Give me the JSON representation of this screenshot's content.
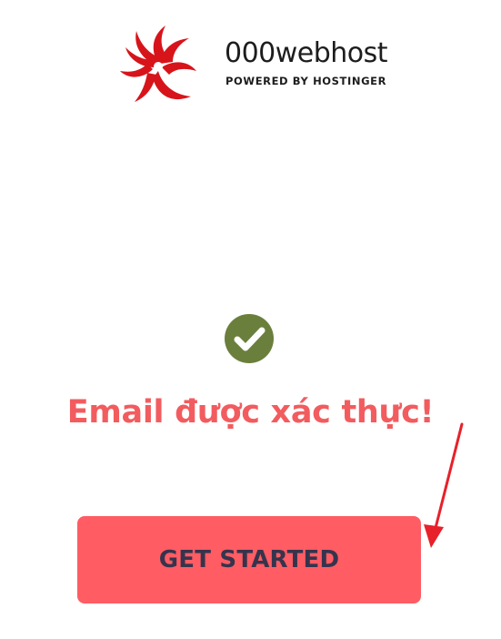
{
  "brand": {
    "name": "000webhost",
    "tagline": "POWERED BY HOSTINGER",
    "logo_icon": "spiral-logo-icon",
    "color": "#d7141a"
  },
  "status": {
    "icon": "check-circle-icon",
    "icon_color": "#6b7f3d",
    "message": "Email được xác thực!",
    "message_color": "#f25c5f"
  },
  "actions": {
    "get_started_label": "GET STARTED",
    "button_color": "#ff5c63"
  },
  "annotation": {
    "icon": "red-arrow-icon",
    "color": "#e8202a"
  }
}
